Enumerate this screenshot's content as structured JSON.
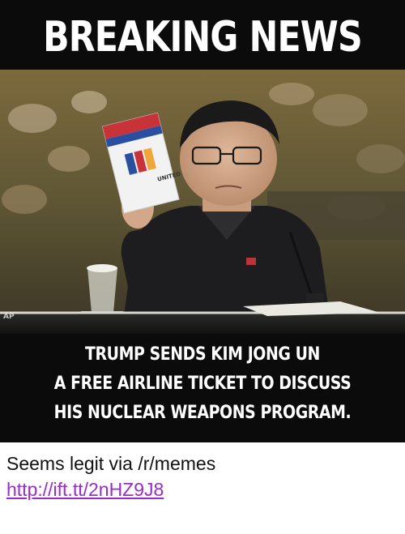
{
  "meme": {
    "headline": "BREAKING NEWS",
    "watermark": "AP",
    "caption_lines": [
      "TRUMP SENDS KIM JONG UN",
      "A FREE AIRLINE TICKET TO DISCUSS",
      "HIS NUCLEAR WEAPONS PROGRAM."
    ],
    "ticket_text": "UNITED"
  },
  "post": {
    "text": "Seems legit via /r/memes",
    "link": "http://ift.tt/2nHZ9J8"
  },
  "colors": {
    "meme_background": "#0b0b0b",
    "headline_text": "#ffffff",
    "link": "#9b2cc9",
    "body_text": "#111111"
  }
}
